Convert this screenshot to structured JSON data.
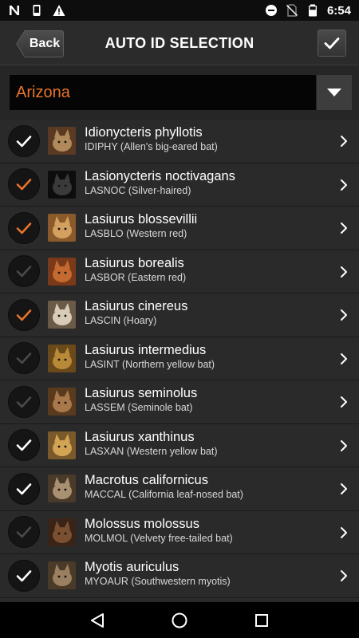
{
  "status_bar": {
    "time": "6:54",
    "left_icons": [
      "n-notification-icon",
      "phone-icon",
      "warning-icon"
    ],
    "right_icons": [
      "do-not-disturb-icon",
      "no-sim-icon",
      "battery-icon"
    ]
  },
  "header": {
    "back_label": "Back",
    "title": "AUTO ID SELECTION"
  },
  "region": {
    "selected": "Arizona"
  },
  "colors": {
    "accent": "#e8742a",
    "checked_white": "#ffffff",
    "unchecked": "#4a4a4a"
  },
  "species": [
    {
      "name": "Idionycteris phyllotis",
      "code": "IDIPHY (Allen's big-eared bat)",
      "state": "white"
    },
    {
      "name": "Lasionycteris noctivagans",
      "code": "LASNOC (Silver-haired)",
      "state": "orange"
    },
    {
      "name": "Lasiurus blossevillii",
      "code": "LASBLO (Western red)",
      "state": "orange"
    },
    {
      "name": "Lasiurus borealis",
      "code": "LASBOR (Eastern red)",
      "state": "off"
    },
    {
      "name": "Lasiurus cinereus",
      "code": "LASCIN (Hoary)",
      "state": "orange"
    },
    {
      "name": "Lasiurus intermedius",
      "code": "LASINT (Northern yellow bat)",
      "state": "off"
    },
    {
      "name": "Lasiurus seminolus",
      "code": "LASSEM (Seminole bat)",
      "state": "off"
    },
    {
      "name": "Lasiurus xanthinus",
      "code": "LASXAN (Western yellow bat)",
      "state": "white"
    },
    {
      "name": "Macrotus californicus",
      "code": "MACCAL (California leaf-nosed bat)",
      "state": "white"
    },
    {
      "name": "Molossus molossus",
      "code": "MOLMOL (Velvety free-tailed bat)",
      "state": "off"
    },
    {
      "name": "Myotis auriculus",
      "code": "MYOAUR (Southwestern myotis)",
      "state": "white"
    }
  ],
  "nav_bar": {
    "buttons": [
      "back-nav-icon",
      "home-nav-icon",
      "recents-nav-icon"
    ]
  }
}
